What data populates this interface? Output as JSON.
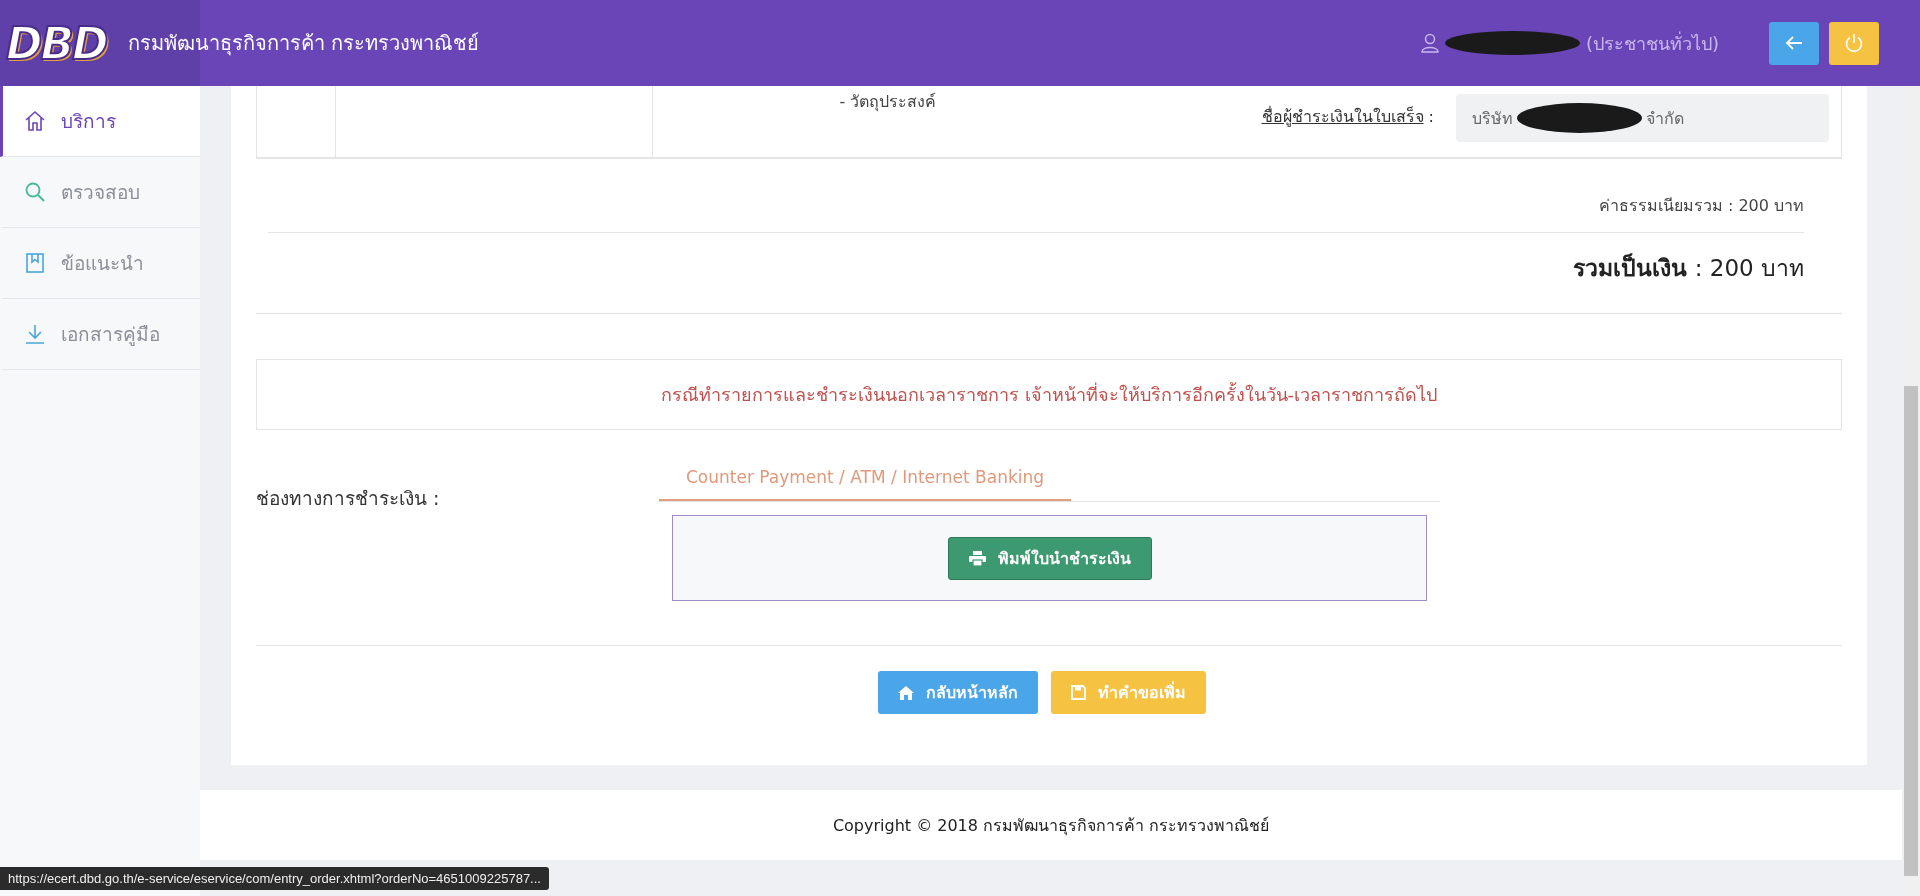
{
  "header": {
    "logo": "DBD",
    "title": "กรมพัฒนาธุรกิจการค้า กระทรวงพาณิชย์",
    "user_role": "(ประชาชนทั่วไป)"
  },
  "sidebar": {
    "items": [
      {
        "label": "บริการ",
        "selected": true
      },
      {
        "label": "ตรวจสอบ",
        "selected": false
      },
      {
        "label": "ข้อแนะนำ",
        "selected": false
      },
      {
        "label": "เอกสารคู่มือ",
        "selected": false
      }
    ]
  },
  "order_table": {
    "purpose": "- วัตถุประสงค์",
    "payer_label": "ชื่อผู้ชำระเงินในใบเสร็จ",
    "payer_colon": ":",
    "payer_value_start": "บริษัท",
    "payer_value_end": "จำกัด"
  },
  "totals": {
    "fee": "ค่าธรรมเนียมรวม : 200 บาท",
    "total_label": "รวมเป็นเงิน",
    "total_value": ": 200 บาท"
  },
  "notice": "กรณีทำรายการและชำระเงินนอกเวลาราชการ เจ้าหน้าที่จะให้บริการอีกครั้งในวัน-เวลาราชการถัดไป",
  "payment": {
    "label": "ช่องทางการชำระเงิน :",
    "tabs": [
      {
        "label": "Counter Payment / ATM / Internet Banking",
        "selected": true
      }
    ],
    "print_button": "พิมพ์ใบนำชำระเงิน"
  },
  "actions": [
    {
      "label": "กลับหน้าหลัก",
      "kind": "home"
    },
    {
      "label": "ทำคำขอเพิ่ม",
      "kind": "save"
    }
  ],
  "footer": {
    "copyright": "Copyright © 2018 กรมพัฒนาธุรกิจการค้า กระทรวงพาณิชย์"
  },
  "status_bar": {
    "url": "https://ecert.dbd.go.th/e-service/eservice/com/entry_order.xhtml?orderNo=4651009225787..."
  }
}
